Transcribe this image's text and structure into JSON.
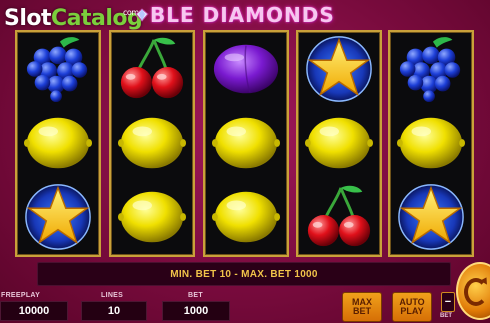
{
  "watermark": {
    "slot": "Slot",
    "catalog": "Catalog",
    "com": "com"
  },
  "game": {
    "title": "BLE DIAMONDS"
  },
  "reels": [
    [
      "grapes",
      "lemon",
      "star"
    ],
    [
      "cherries",
      "lemon",
      "lemon"
    ],
    [
      "plum",
      "lemon",
      "lemon"
    ],
    [
      "star",
      "lemon",
      "cherries"
    ],
    [
      "grapes",
      "lemon",
      "star"
    ]
  ],
  "message": "MIN. BET 10 - MAX. BET 1000",
  "freeplay": {
    "label": "FREEPLAY",
    "value": "10000"
  },
  "lines": {
    "label": "LINES",
    "value": "10"
  },
  "bet": {
    "label": "BET",
    "value": "1000"
  },
  "buttons": {
    "max_bet": [
      "MAX",
      "BET"
    ],
    "auto_play": [
      "AUTO",
      "PLAY"
    ],
    "bet_minus": "−",
    "bet_minus_label": "BET"
  },
  "colors": {
    "frame": "#c9a13a",
    "message_text": "#f1c44a",
    "background": "#7a0b3e"
  }
}
